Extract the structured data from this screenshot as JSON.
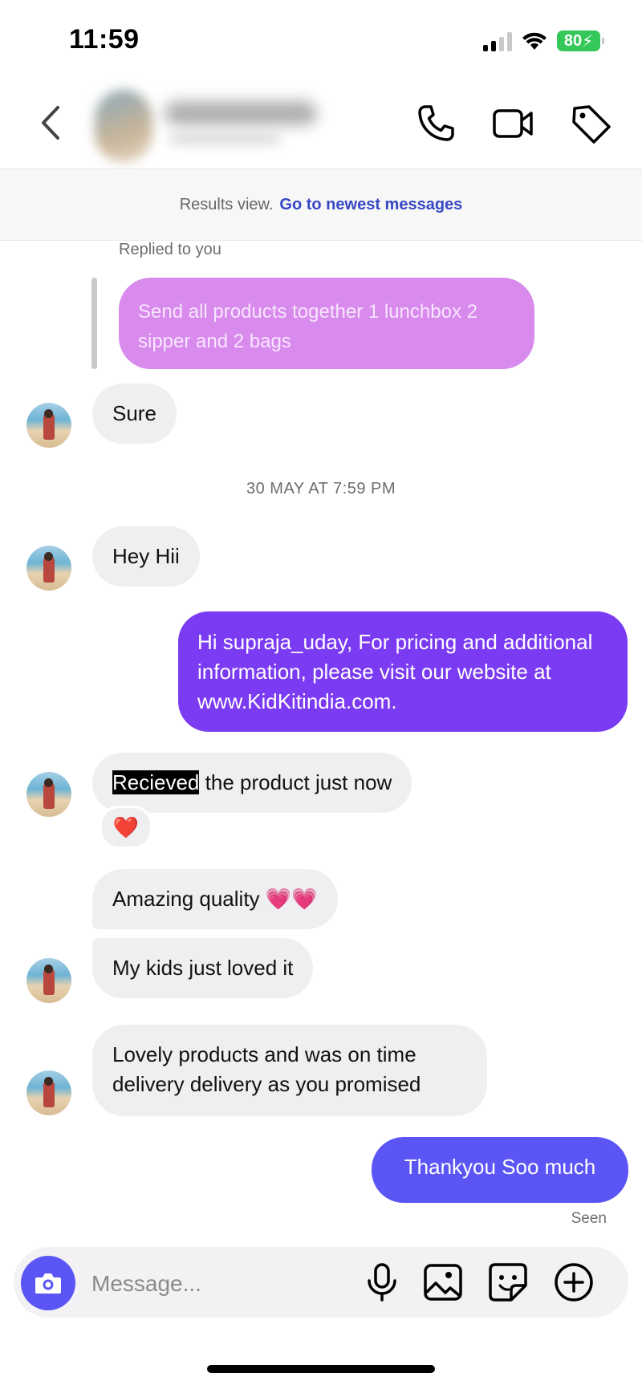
{
  "status": {
    "time": "11:59",
    "battery": "80"
  },
  "header": {
    "back_icon": "chevron-left-icon",
    "actions": [
      "phone-icon",
      "video-icon",
      "tag-icon"
    ]
  },
  "banner": {
    "text": "Results view.",
    "link": "Go to newest messages"
  },
  "colors": {
    "outgoing_1": "#7b3bf2",
    "outgoing_2": "#5b55f5",
    "reply": "#d88aed",
    "incoming": "#efeff1",
    "link": "#3747c4"
  },
  "messages": {
    "replied_label": "Replied to you",
    "reply_quote": "Send all products together 1 lunchbox 2 sipper and 2 bags",
    "sure": "Sure",
    "date_separator": "30 MAY AT 7:59 PM",
    "hey": "Hey Hii",
    "outgoing_info": "Hi supraja_uday, For pricing and additional information, please visit our website at www.KidKitindia.com.",
    "received_highlight": "Recieved",
    "received_rest": " the product just now",
    "reaction": "❤️",
    "amazing": "Amazing quality 💗💗",
    "kids": "My kids just loved it",
    "lovely": "Lovely products and was on time delivery delivery as you promised",
    "thankyou": "Thankyou Soo much",
    "seen": "Seen"
  },
  "composer": {
    "placeholder": "Message..."
  }
}
